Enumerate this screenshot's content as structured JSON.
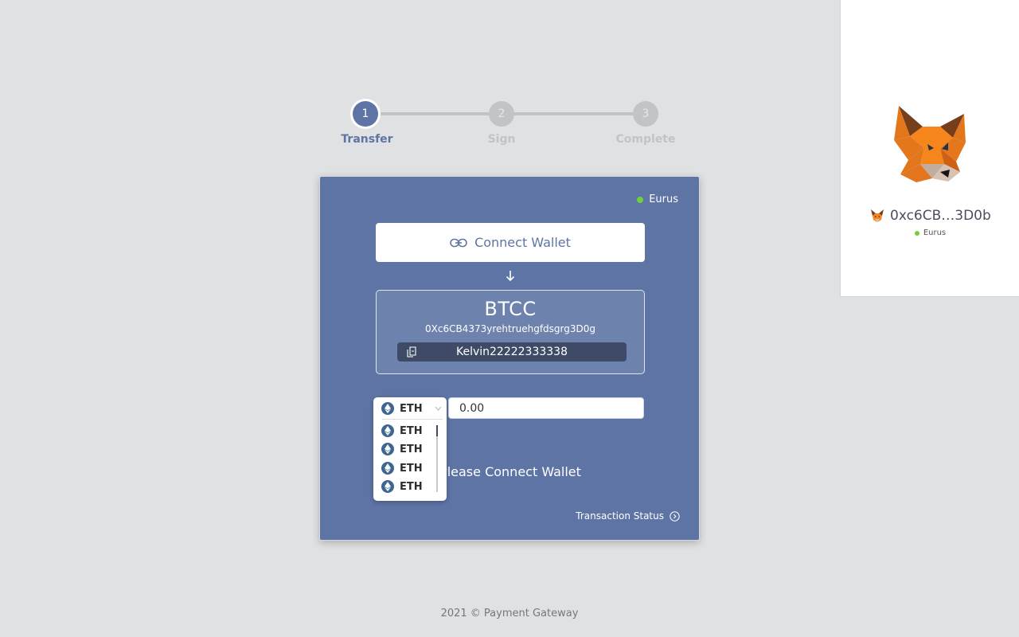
{
  "stepper": {
    "steps": [
      {
        "number": "1",
        "label": "Transfer",
        "state": "active"
      },
      {
        "number": "2",
        "label": "Sign",
        "state": "inactive"
      },
      {
        "number": "3",
        "label": "Complete",
        "state": "inactive"
      }
    ]
  },
  "card": {
    "network": "Eurus",
    "connect_button": "Connect Wallet",
    "destination": {
      "name": "BTCC",
      "address": "0Xc6CB4373yrehtruehgfdsgrg3D0g",
      "memo": "Kelvin22222333338"
    },
    "currency": {
      "selected": "ETH",
      "options": [
        "ETH",
        "ETH",
        "ETH",
        "ETH"
      ]
    },
    "amount": {
      "value": "0.00"
    },
    "message": "Please Connect Wallet",
    "transaction_status_link": "Transaction Status"
  },
  "footer": {
    "text": "2021 © Payment Gateway"
  },
  "metamask": {
    "account": "0xc6CB…3D0b",
    "network": "Eurus"
  },
  "colors": {
    "accent": "#5e74a5",
    "background": "#e0e1e3",
    "status_green": "#6fd13b",
    "memo_bar": "#3f4b66"
  },
  "icons": [
    "link-icon",
    "arrow-down-icon",
    "copy-icon",
    "eth-icon",
    "chevron-down-icon",
    "arrow-right-circle-icon",
    "metamask-fox-icon"
  ]
}
